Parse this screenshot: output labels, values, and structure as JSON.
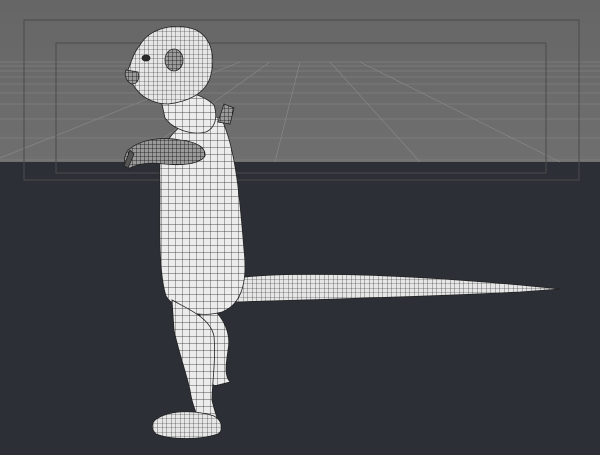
{
  "viewport": {
    "view": "3d-perspective",
    "shading": "wireframe-on-shaded",
    "colors": {
      "backdrop_upper": "#6b6b6b",
      "backdrop_lower": "#2c3036",
      "grid_line": "#808080",
      "frame_line": "#4a4a4a",
      "mesh_fill": "#e9e9e9",
      "mesh_wire": "#1a1a1a"
    }
  },
  "scene": {
    "object": "character-mesh",
    "subject": "meerkat-character-model",
    "pose": "standing-side-view"
  }
}
